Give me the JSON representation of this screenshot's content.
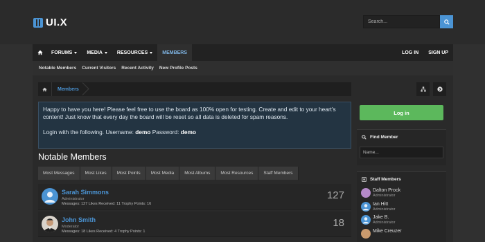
{
  "logo": {
    "text": "UI.X"
  },
  "search": {
    "placeholder": "Search..."
  },
  "nav": {
    "items": [
      {
        "label": "FORUMS"
      },
      {
        "label": "MEDIA"
      },
      {
        "label": "RESOURCES"
      },
      {
        "label": "MEMBERS"
      }
    ],
    "login": "LOG IN",
    "signup": "SIGN UP"
  },
  "subnav": [
    "Notable Members",
    "Current Visitors",
    "Recent Activity",
    "New Profile Posts"
  ],
  "breadcrumb": {
    "current": "Members"
  },
  "notice": {
    "line1": "Happy to have you here! Please feel free to use the board as 100% open for testing. Create and edit to your heart's content! Just know that every day the board will be reset so all data is deleted for spam reasons.",
    "login_prefix": "Login with the following. Username: ",
    "username": "demo",
    "password_label": " Password: ",
    "password": "demo"
  },
  "section_title": "Notable Members",
  "tabs": [
    "Most Messages",
    "Most Likes",
    "Most Points",
    "Most Media",
    "Most Albums",
    "Most Resources",
    "Staff Members"
  ],
  "members": [
    {
      "name": "Sarah Simmons",
      "role": "Administrator",
      "stats": "Messages: 127 Likes Received: 11 Trophy Points: 16",
      "count": "127"
    },
    {
      "name": "John Smith",
      "role": "Moderator",
      "stats": "Messages: 18 Likes Received: 4 Trophy Points: 1",
      "count": "18"
    }
  ],
  "sidebar": {
    "login_button": "Log in",
    "find_member": {
      "title": "Find Member",
      "placeholder": "Name..."
    },
    "staff": {
      "title": "Staff Members",
      "members": [
        {
          "name": "Dalton Prock",
          "role": "Administrator"
        },
        {
          "name": "Ian Hitt",
          "role": "Administrator"
        },
        {
          "name": "Jake B.",
          "role": "Administrator"
        },
        {
          "name": "Mike Creuzer",
          "role": ""
        }
      ]
    }
  },
  "colors": {
    "accent": "#4b94d4",
    "login_green": "#5cb85c"
  }
}
